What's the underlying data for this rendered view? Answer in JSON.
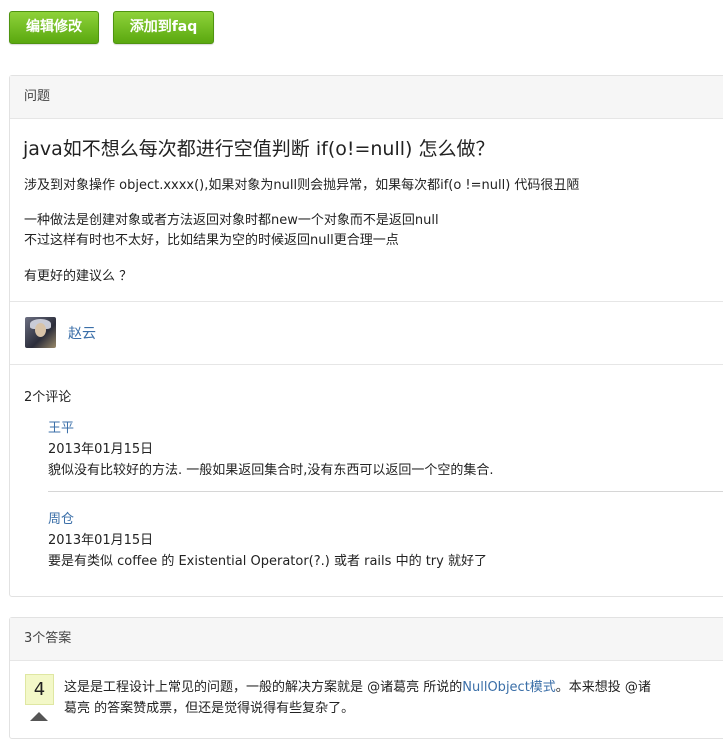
{
  "toolbar": {
    "edit_label": "编辑修改",
    "add_faq_label": "添加到faq",
    "accent_color": "#6cbf1a"
  },
  "question": {
    "header": "问题",
    "title": "java如不想么每次都进行空值判断 if(o!=null) 怎么做？",
    "p1": "涉及到对象操作 object.xxxx(),如果对象为null则会抛异常，如果每次都if(o !=null) 代码很丑陋",
    "p2a": "一种做法是创建对象或者方法返回对象时都new一个对象而不是返回null",
    "p2b": "不过这样有时也不太好，比如结果为空的时候返回null更合理一点",
    "p3": "有更好的建议么 ？",
    "author": "赵云"
  },
  "comments": {
    "count_label": "2个评论",
    "items": [
      {
        "user": "王平",
        "date": "2013年01月15日",
        "text": "貌似没有比较好的方法. 一般如果返回集合时,没有东西可以返回一个空的集合."
      },
      {
        "user": "周仓",
        "date": "2013年01月15日",
        "text": "要是有类似 coffee 的 Existential Operator(?.) 或者 rails 中的 try 就好了"
      }
    ]
  },
  "answers": {
    "header": "3个答案",
    "first": {
      "votes": "4",
      "text_before": "这是是工程设计上常见的问题，一般的解决方案就是 @诸葛亮 所说的",
      "link": "NullObject模式",
      "text_after": "。本来想投 @诸",
      "line2": "葛亮 的答案赞成票，但还是觉得说得有些复杂了。"
    }
  }
}
